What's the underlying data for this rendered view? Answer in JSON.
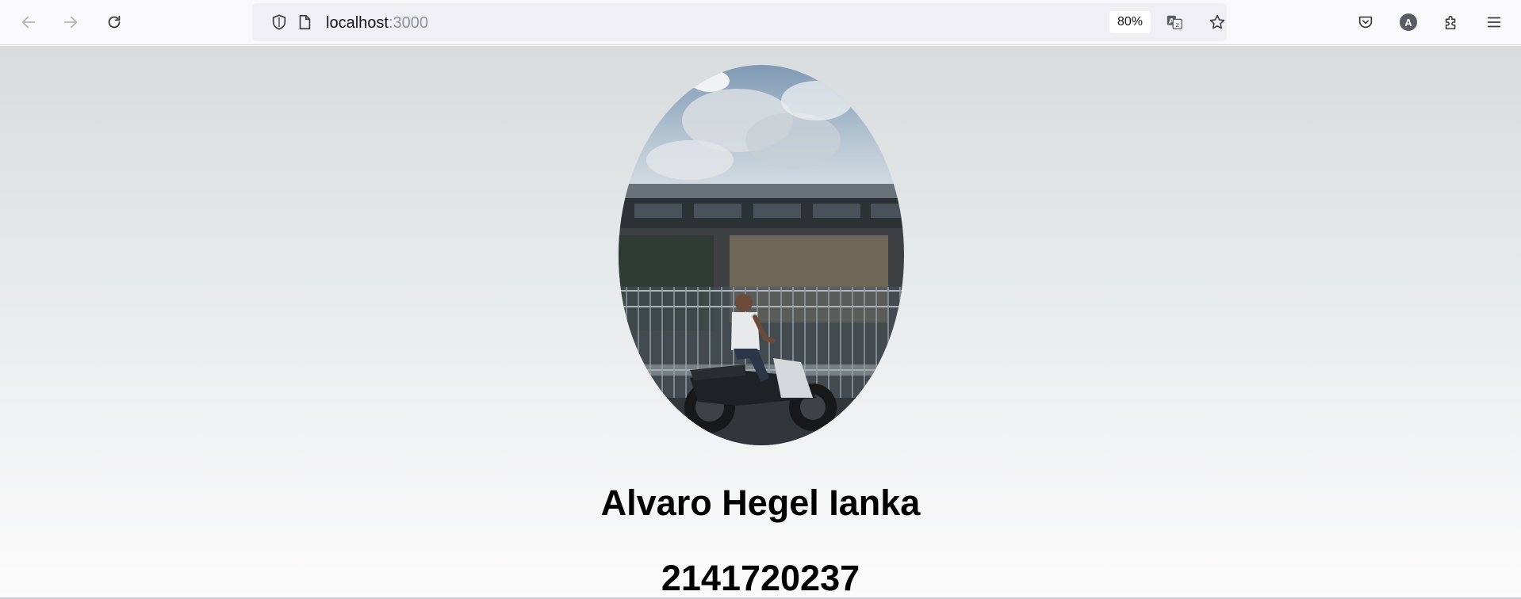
{
  "browser": {
    "url_host": "localhost",
    "url_port": ":3000",
    "zoom_level": "80%",
    "account_initial": "A",
    "icons": {
      "back": "arrow-left-icon",
      "forward": "arrow-right-icon",
      "reload": "reload-icon",
      "tracking_protection": "shield-icon",
      "page_info": "page-icon",
      "translate": "translate-icon",
      "bookmark": "star-icon",
      "pocket": "pocket-icon",
      "account": "account-icon",
      "extensions": "puzzle-icon",
      "menu": "hamburger-menu-icon"
    }
  },
  "profile": {
    "name": "Alvaro Hegel Ianka",
    "nim": "2141720237"
  }
}
